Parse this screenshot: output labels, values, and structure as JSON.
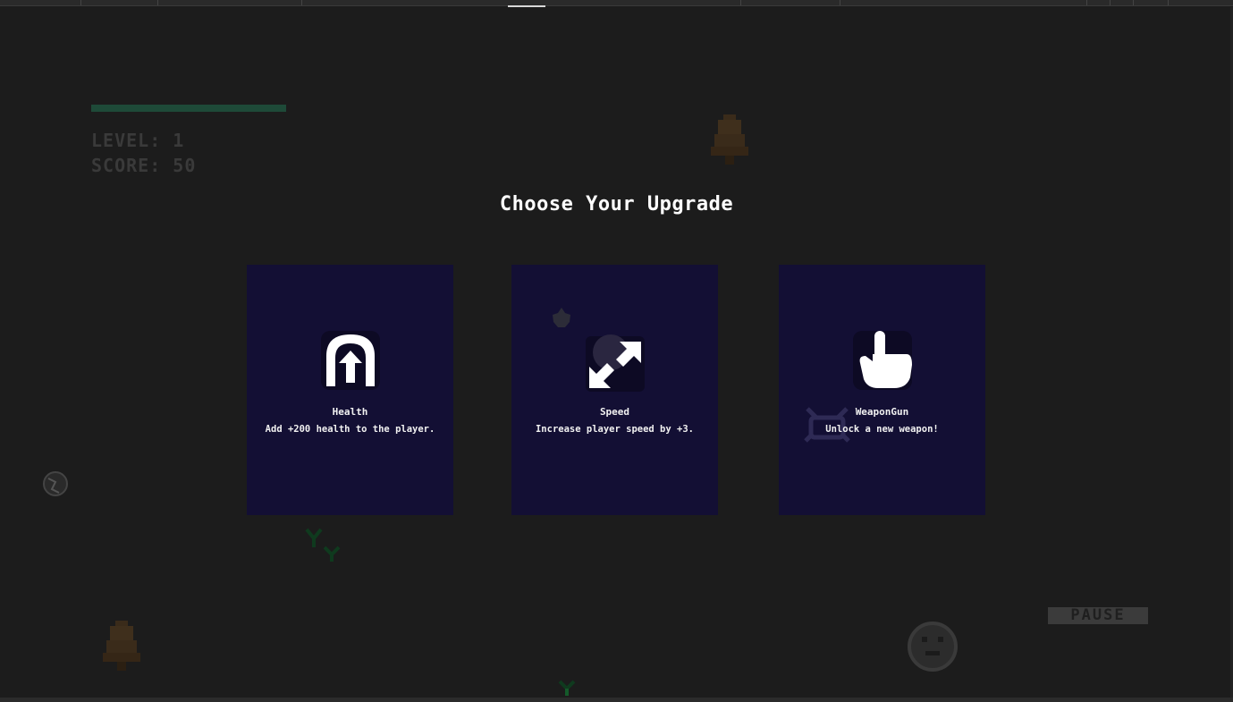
{
  "hud": {
    "level_text": "LEVEL: 1",
    "score_text": "SCORE: 50",
    "health_fraction": 1.0
  },
  "upgrade_menu": {
    "title": "Choose Your Upgrade",
    "cards": [
      {
        "name": "Health",
        "description": "Add +200 health to the player.",
        "icon": "health-arch-arrow-icon"
      },
      {
        "name": "Speed",
        "description": "Increase player speed by +3.",
        "icon": "speed-arrows-icon"
      },
      {
        "name": "WeaponGun",
        "description": "Unlock a new weapon!",
        "icon": "pointing-hand-icon"
      }
    ]
  },
  "controls": {
    "pause_label": "PAUSE"
  },
  "colors": {
    "background": "#1c1c1c",
    "card": "#130f34",
    "title_text": "#ffffff",
    "health_bar": "#1e4a38",
    "hud_text": "#3a3a3a",
    "pause_button": "#3b3b3b"
  },
  "background_sprites": [
    "bell-sprite",
    "bell-sprite",
    "globe-sprite",
    "grass-sprite",
    "grass-sprite",
    "face-sprite",
    "blob-sprite",
    "crab-sprite",
    "grass-sprite"
  ]
}
